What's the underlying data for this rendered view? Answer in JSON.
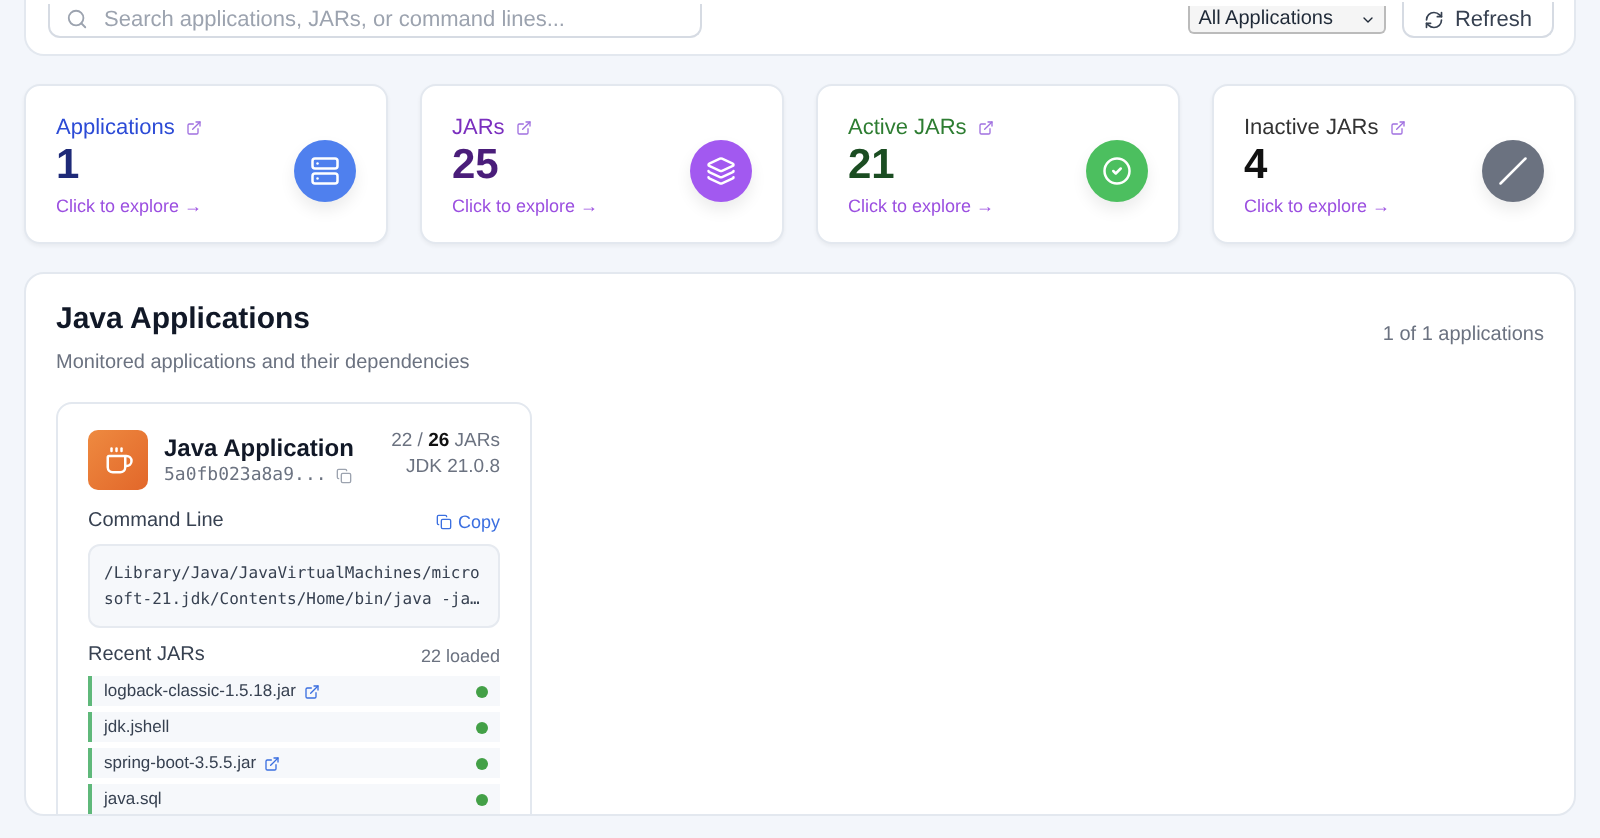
{
  "toolbar": {
    "search": {
      "placeholder": "Search applications, JARs, or command lines..."
    },
    "filter": {
      "value": "All Applications"
    },
    "refresh": {
      "label": "Refresh"
    }
  },
  "stats": [
    {
      "kind": "server",
      "label": "Applications",
      "value": "1",
      "link": "Click to explore →",
      "color": "#4f80ee"
    },
    {
      "kind": "layers",
      "label": "JARs",
      "value": "25",
      "link": "Click to explore →",
      "color": "#a259f0"
    },
    {
      "kind": "check",
      "label": "Active JARs",
      "value": "21",
      "link": "Click to explore →",
      "color": "#4cbf5f"
    },
    {
      "kind": "slash",
      "label": "Inactive JARs",
      "value": "4",
      "link": "Click to explore →",
      "color": "#6b7280"
    }
  ],
  "panel": {
    "title": "Java Applications",
    "subtitle": "Monitored applications and their dependencies",
    "count": "1 of 1 applications",
    "apps": [
      {
        "name": "Java Application",
        "id": "5a0fb023a8a9...",
        "loaded": "22",
        "separator": "/",
        "total": "26",
        "unit": "JARs",
        "jdk": "JDK 21.0.8",
        "command_label": "Command Line",
        "copy": "Copy",
        "command": "/Library/Java/JavaVirtualMachines/microsoft-21.jdk/Contents/Home/bin/java -ja…",
        "recent_label": "Recent JARs",
        "recent_count": "22 loaded",
        "jars": [
          {
            "name": "logback-classic-1.5.18.jar",
            "external": true,
            "color": "#43a047"
          },
          {
            "name": "jdk.jshell",
            "external": false,
            "color": "#43a047"
          },
          {
            "name": "spring-boot-3.5.5.jar",
            "external": true,
            "color": "#43a047"
          },
          {
            "name": "java.sql",
            "external": false,
            "color": "#43a047"
          }
        ]
      }
    ]
  }
}
